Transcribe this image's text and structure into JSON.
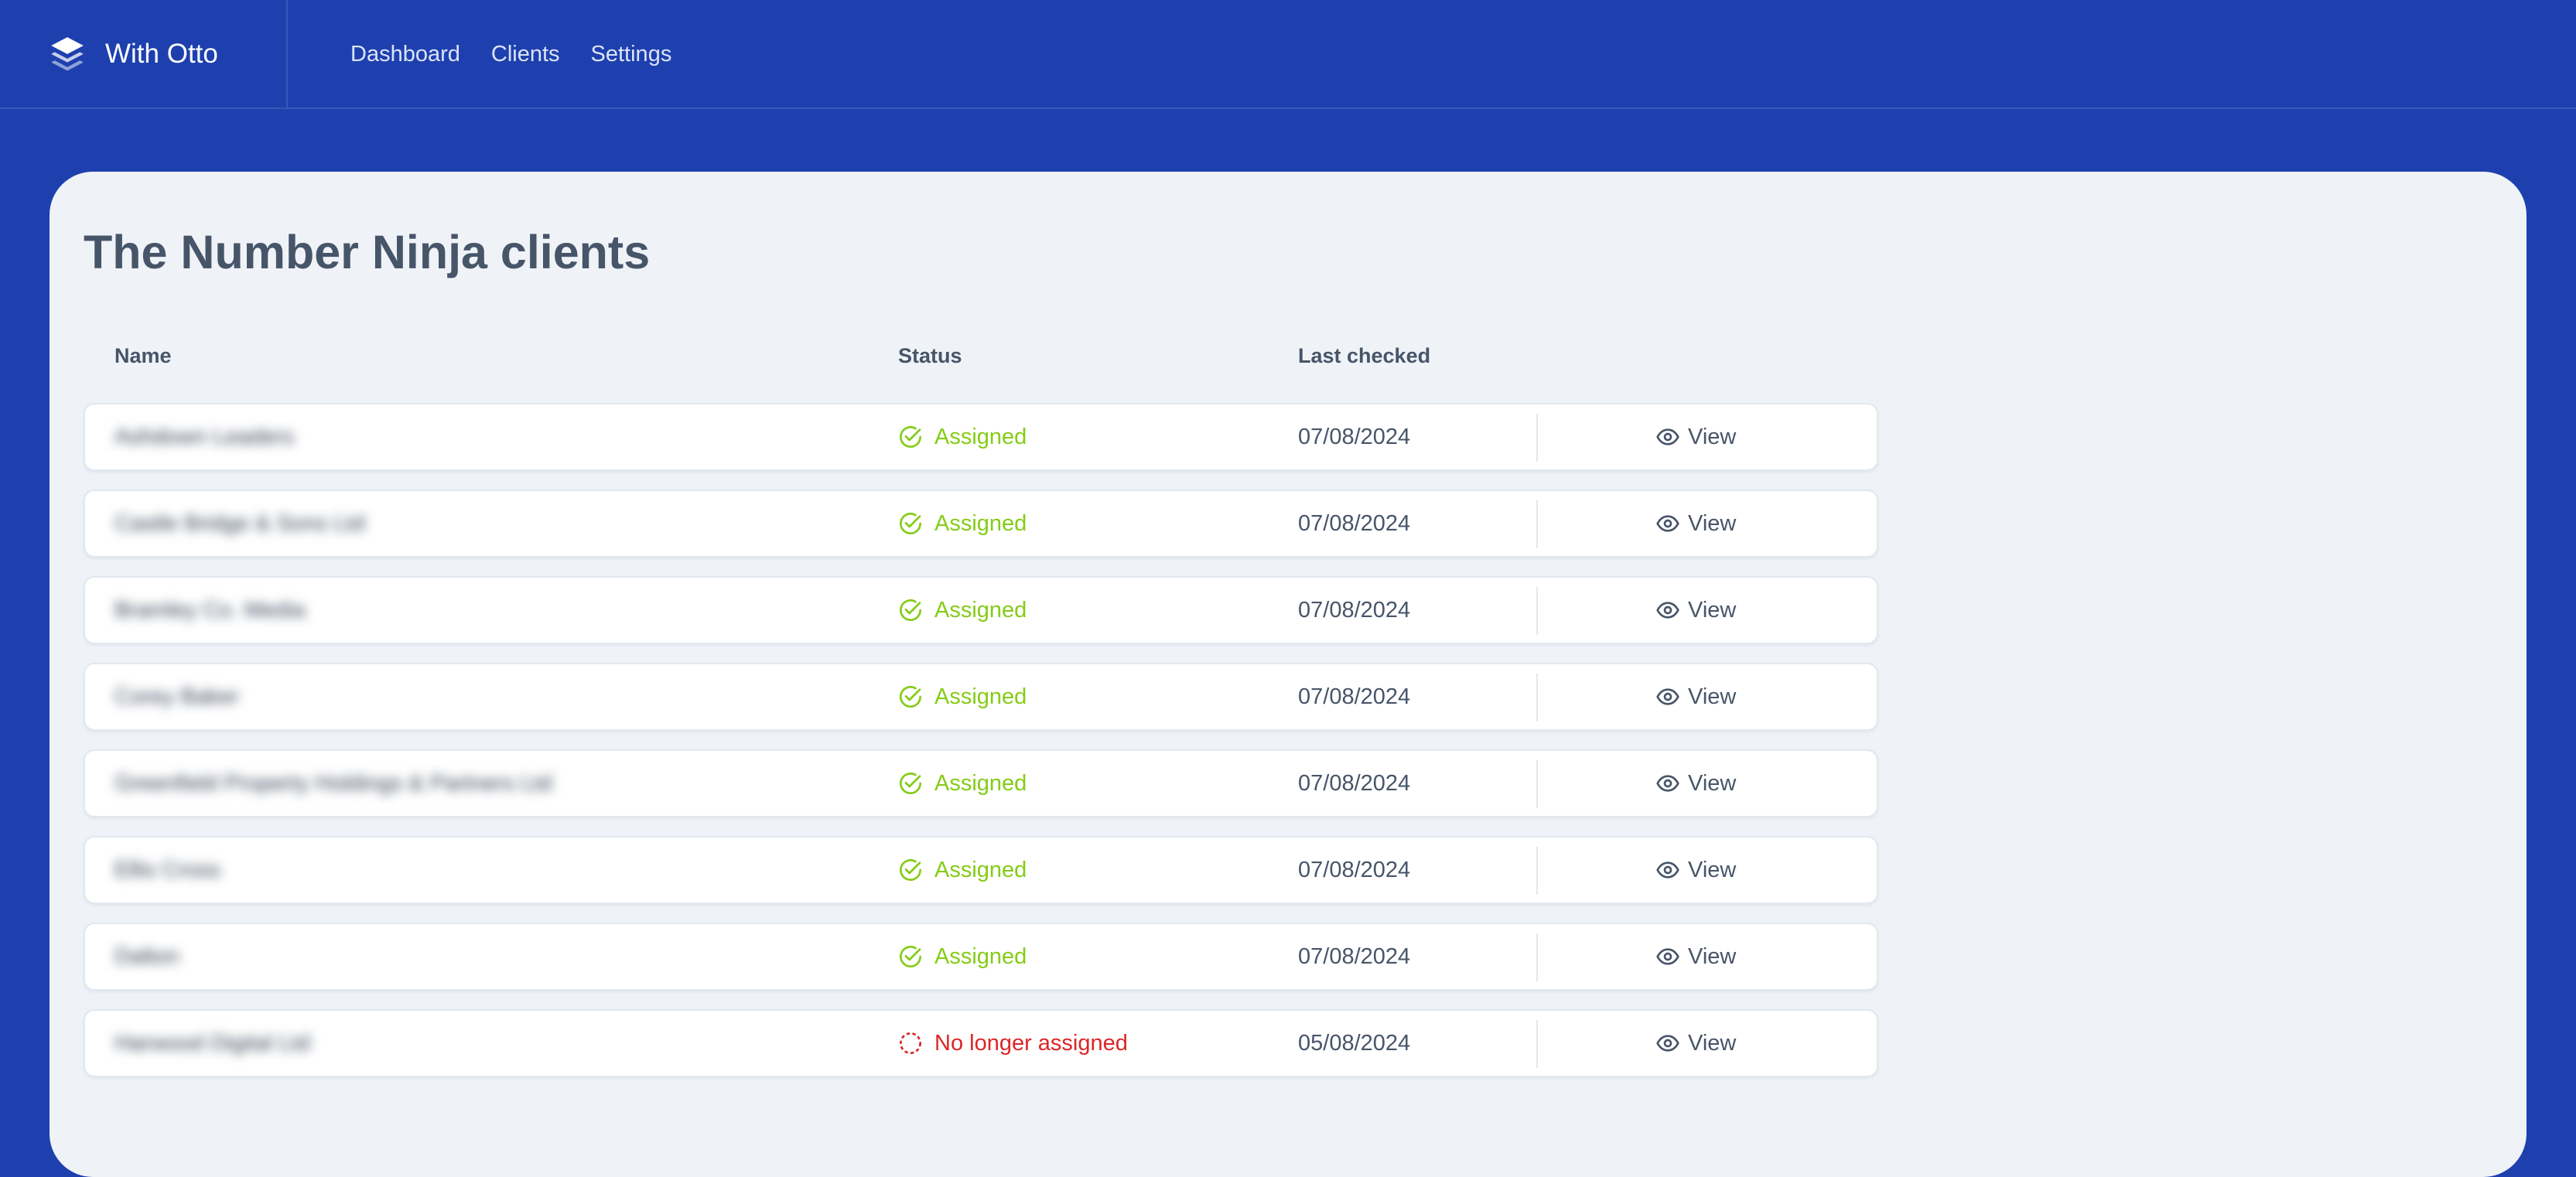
{
  "app": {
    "brand_name": "With Otto",
    "logo_icon": "layers-icon"
  },
  "nav": {
    "items": [
      {
        "label": "Dashboard"
      },
      {
        "label": "Clients"
      },
      {
        "label": "Settings"
      }
    ]
  },
  "page": {
    "title": "The Number Ninja clients"
  },
  "table": {
    "columns": [
      "Name",
      "Status",
      "Last checked"
    ],
    "view_label": "View",
    "rows": [
      {
        "name": "Ashdown Leaders",
        "status": "Assigned",
        "status_kind": "assigned",
        "last_checked": "07/08/2024"
      },
      {
        "name": "Castle Bridge & Sons Ltd",
        "status": "Assigned",
        "status_kind": "assigned",
        "last_checked": "07/08/2024"
      },
      {
        "name": "Bramley Co. Media",
        "status": "Assigned",
        "status_kind": "assigned",
        "last_checked": "07/08/2024"
      },
      {
        "name": "Corey Baker",
        "status": "Assigned",
        "status_kind": "assigned",
        "last_checked": "07/08/2024"
      },
      {
        "name": "Greenfield Property Holdings & Partners Ltd",
        "status": "Assigned",
        "status_kind": "assigned",
        "last_checked": "07/08/2024"
      },
      {
        "name": "Ellis Cross",
        "status": "Assigned",
        "status_kind": "assigned",
        "last_checked": "07/08/2024"
      },
      {
        "name": "Dalton",
        "status": "Assigned",
        "status_kind": "assigned",
        "last_checked": "07/08/2024"
      },
      {
        "name": "Harwood Digital Ltd",
        "status": "No longer assigned",
        "status_kind": "unassigned",
        "last_checked": "05/08/2024"
      }
    ]
  },
  "colors": {
    "header_bg": "#1e40af",
    "panel_bg": "#eff3f8",
    "assigned": "#84cc16",
    "unassigned": "#dc2626",
    "text_muted": "#475569"
  }
}
